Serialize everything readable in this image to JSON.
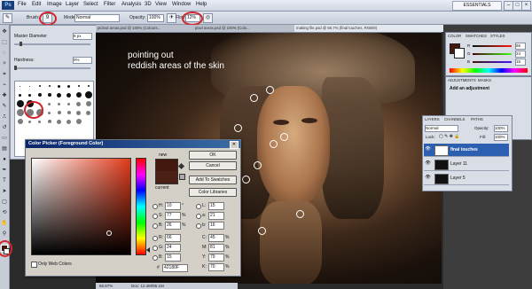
{
  "menubar": {
    "logo": "Ps",
    "items": [
      "File",
      "Edit",
      "Image",
      "Layer",
      "Select",
      "Filter",
      "Analysis",
      "3D",
      "View",
      "Window",
      "Help"
    ],
    "workspace": "ESSENTIALS",
    "window_buttons": [
      "–",
      "□",
      "×"
    ]
  },
  "options": {
    "brush_label": "Brush:",
    "brush_size": "9",
    "mode_label": "Mode:",
    "mode_value": "Normal",
    "opacity_label": "Opacity:",
    "opacity_value": "100%",
    "flow_label": "Flow:",
    "flow_value": "12%"
  },
  "brush_panel": {
    "master_label": "Master Diameter",
    "master_value": "9 px",
    "hardness_label": "Hardness:",
    "hardness_value": "0%",
    "brush_sizes": [
      "1",
      "3",
      "5",
      "9",
      "13",
      "19",
      "5",
      "9",
      "13",
      "17",
      "21",
      "27",
      "35",
      "45",
      "65",
      "100",
      "200",
      "300",
      "9",
      "13",
      "19",
      "17",
      "45",
      "65",
      "100",
      "200",
      "300",
      "14",
      "24",
      "27",
      "39",
      "46",
      "59",
      "11",
      "17",
      "23",
      "36",
      "44",
      "60"
    ]
  },
  "tabs": [
    "picked areas.psd @ 100% (Colours...",
    "pixel areas.psd @ 100% (Colo...",
    "making file.psd @ 66.7% (final touches, RGB/8)"
  ],
  "canvas": {
    "annotation_line1": "pointing out",
    "annotation_line2": "reddish areas of the skin"
  },
  "status": {
    "zoom": "66.67%",
    "doc": "Doc: 12.4M/85.1M"
  },
  "picker": {
    "title": "Color Picker (Foreground Color)",
    "ok": "OK",
    "cancel": "Cancel",
    "add_swatches": "Add To Swatches",
    "color_libraries": "Color Libraries",
    "new_label": "new",
    "current_label": "current",
    "hsb": [
      {
        "label": "H:",
        "value": "10",
        "unit": "°"
      },
      {
        "label": "S:",
        "value": "77",
        "unit": "%"
      },
      {
        "label": "B:",
        "value": "26",
        "unit": "%"
      }
    ],
    "rgb": [
      {
        "label": "R:",
        "value": "66"
      },
      {
        "label": "G:",
        "value": "24"
      },
      {
        "label": "B:",
        "value": "15"
      }
    ],
    "lab": [
      {
        "label": "L:",
        "value": "15"
      },
      {
        "label": "a:",
        "value": "21"
      },
      {
        "label": "b:",
        "value": "16"
      }
    ],
    "cmyk": [
      {
        "label": "C:",
        "value": "45",
        "unit": "%"
      },
      {
        "label": "M:",
        "value": "81",
        "unit": "%"
      },
      {
        "label": "Y:",
        "value": "79",
        "unit": "%"
      },
      {
        "label": "K:",
        "value": "70",
        "unit": "%"
      }
    ],
    "hex_label": "#",
    "hex": "42180F",
    "web_only": "Only Web Colors",
    "new_color": "#42180f",
    "current_color": "#4a1f14"
  },
  "color_panel": {
    "tabs": [
      "COLOR",
      "SWATCHES",
      "STYLES"
    ],
    "r": "66",
    "g": "24",
    "b": "15",
    "r_label": "R",
    "g_label": "G",
    "b_label": "B"
  },
  "adjustments": {
    "tabs": [
      "ADJUSTMENTS",
      "MASKS"
    ],
    "title": "Add an adjustment"
  },
  "layers": {
    "tabs": [
      "LAYERS",
      "CHANNELS",
      "PATHS"
    ],
    "blend_mode": "Normal",
    "opacity_label": "Opacity:",
    "opacity": "100%",
    "lock_label": "Lock:",
    "fill_label": "Fill:",
    "fill": "100%",
    "items": [
      {
        "name": "final touches",
        "active": true
      },
      {
        "name": "Layer 11",
        "active": false
      },
      {
        "name": "Layer 5",
        "active": false
      }
    ]
  }
}
